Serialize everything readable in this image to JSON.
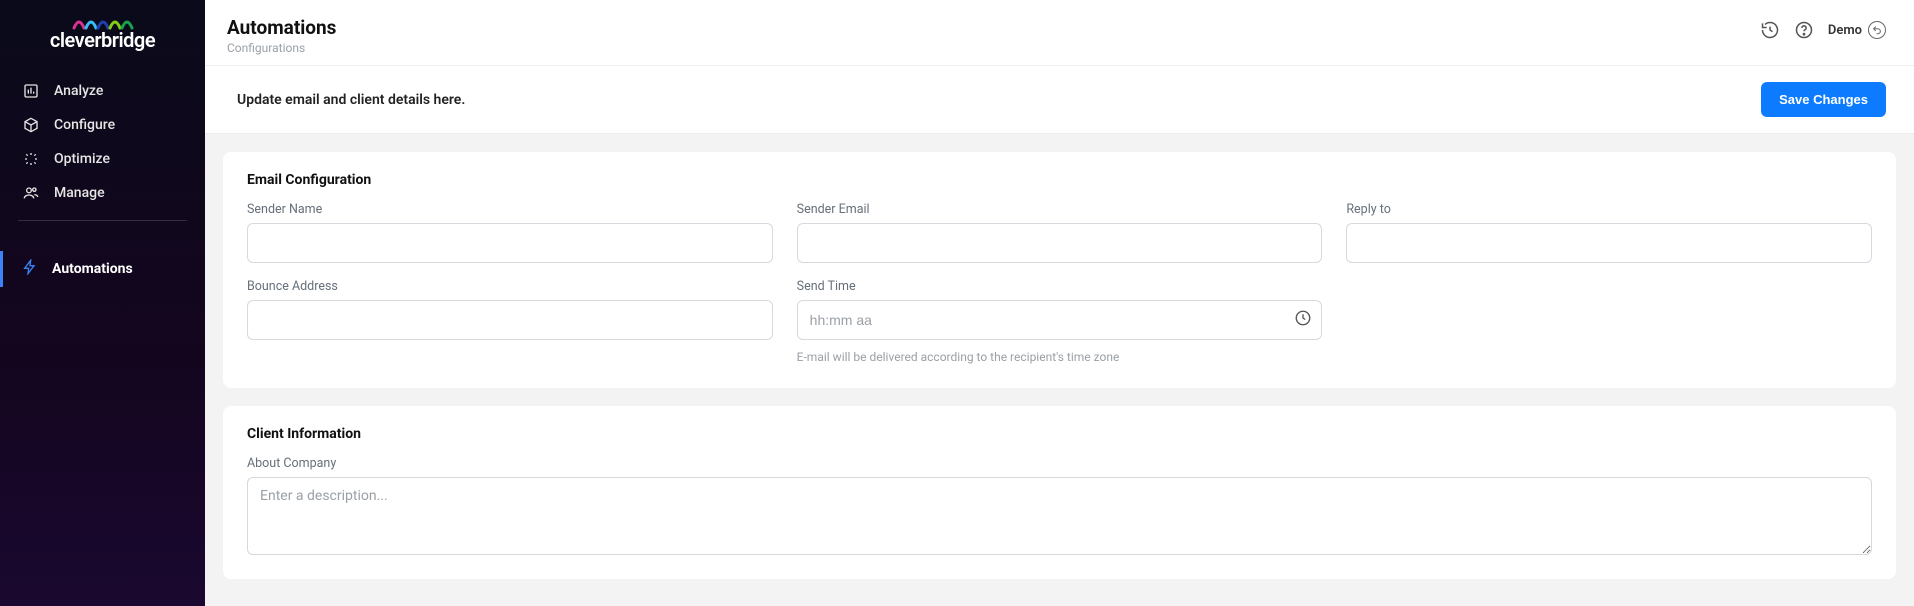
{
  "brand": "cleverbridge",
  "sidebar": {
    "items": [
      {
        "label": "Analyze",
        "icon": "chart-icon"
      },
      {
        "label": "Configure",
        "icon": "cube-icon"
      },
      {
        "label": "Optimize",
        "icon": "spark-icon"
      },
      {
        "label": "Manage",
        "icon": "users-icon"
      }
    ],
    "automations_label": "Automations"
  },
  "header": {
    "title": "Automations",
    "subtitle": "Configurations",
    "demo_label": "Demo"
  },
  "action_bar": {
    "hint": "Update email and client details here.",
    "save_label": "Save Changes"
  },
  "email_config": {
    "section_title": "Email Configuration",
    "sender_name": {
      "label": "Sender Name",
      "value": ""
    },
    "sender_email": {
      "label": "Sender Email",
      "value": ""
    },
    "reply_to": {
      "label": "Reply to",
      "value": ""
    },
    "bounce": {
      "label": "Bounce Address",
      "value": ""
    },
    "send_time": {
      "label": "Send Time",
      "placeholder": "hh:mm aa",
      "value": "",
      "helper": "E-mail will be delivered according to the recipient's time zone"
    }
  },
  "client_info": {
    "section_title": "Client Information",
    "about_label": "About Company",
    "about_placeholder": "Enter a description...",
    "about_value": ""
  }
}
